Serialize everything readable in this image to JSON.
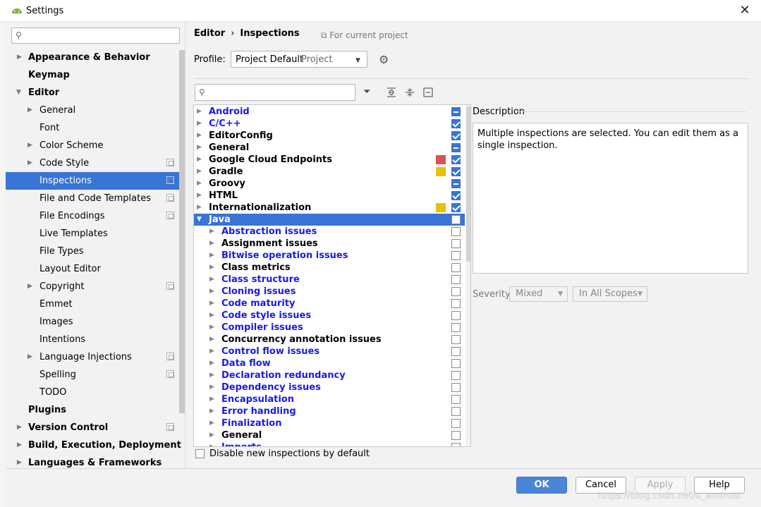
{
  "window": {
    "title": "Settings",
    "close_glyph": "✕"
  },
  "sidebar": {
    "search": {
      "placeholder": ""
    },
    "items": [
      {
        "label": "Appearance & Behavior"
      },
      {
        "label": "Keymap"
      },
      {
        "label": "Editor"
      },
      {
        "label": "General"
      },
      {
        "label": "Font"
      },
      {
        "label": "Color Scheme"
      },
      {
        "label": "Code Style"
      },
      {
        "label": "Inspections"
      },
      {
        "label": "File and Code Templates"
      },
      {
        "label": "File Encodings"
      },
      {
        "label": "Live Templates"
      },
      {
        "label": "File Types"
      },
      {
        "label": "Layout Editor"
      },
      {
        "label": "Copyright"
      },
      {
        "label": "Emmet"
      },
      {
        "label": "Images"
      },
      {
        "label": "Intentions"
      },
      {
        "label": "Language Injections"
      },
      {
        "label": "Spelling"
      },
      {
        "label": "TODO"
      },
      {
        "label": "Plugins"
      },
      {
        "label": "Version Control"
      },
      {
        "label": "Build, Execution, Deployment"
      },
      {
        "label": "Languages & Frameworks"
      }
    ]
  },
  "breadcrumb": {
    "part1": "Editor",
    "separator": "›",
    "part2": "Inspections",
    "scope_note": "For current project"
  },
  "profile": {
    "label": "Profile:",
    "value": "Project Default",
    "scope": "Project"
  },
  "inspections": [
    {
      "name": "Android",
      "state": "partial"
    },
    {
      "name": "C/C++",
      "state": "checked"
    },
    {
      "name": "EditorConfig",
      "state": "checked"
    },
    {
      "name": "General",
      "state": "partial"
    },
    {
      "name": "Google Cloud Endpoints",
      "state": "checked",
      "severity_color": "#d9534f"
    },
    {
      "name": "Gradle",
      "state": "checked",
      "severity_color": "#e6c200"
    },
    {
      "name": "Groovy",
      "state": "partial"
    },
    {
      "name": "HTML",
      "state": "checked"
    },
    {
      "name": "Internationalization",
      "state": "checked",
      "severity_color": "#e6c200"
    },
    {
      "name": "Java",
      "state": "unchecked"
    },
    {
      "name": "Abstraction issues",
      "state": "unchecked"
    },
    {
      "name": "Assignment issues",
      "state": "unchecked"
    },
    {
      "name": "Bitwise operation issues",
      "state": "unchecked"
    },
    {
      "name": "Class metrics",
      "state": "unchecked"
    },
    {
      "name": "Class structure",
      "state": "unchecked"
    },
    {
      "name": "Cloning issues",
      "state": "unchecked"
    },
    {
      "name": "Code maturity",
      "state": "unchecked"
    },
    {
      "name": "Code style issues",
      "state": "unchecked"
    },
    {
      "name": "Compiler issues",
      "state": "unchecked"
    },
    {
      "name": "Concurrency annotation issues",
      "state": "unchecked"
    },
    {
      "name": "Control flow issues",
      "state": "unchecked"
    },
    {
      "name": "Data flow",
      "state": "unchecked"
    },
    {
      "name": "Declaration redundancy",
      "state": "unchecked"
    },
    {
      "name": "Dependency issues",
      "state": "unchecked"
    },
    {
      "name": "Encapsulation",
      "state": "unchecked"
    },
    {
      "name": "Error handling",
      "state": "unchecked"
    },
    {
      "name": "Finalization",
      "state": "unchecked"
    },
    {
      "name": "General",
      "state": "unchecked"
    },
    {
      "name": "Imports",
      "state": "unchecked"
    }
  ],
  "description": {
    "title": "Description",
    "text": "Multiple inspections are selected. You can edit them as a single inspection."
  },
  "severity": {
    "label": "Severity:",
    "value": "Mixed",
    "scope": "In All Scopes"
  },
  "disable_new": {
    "label": "Disable new inspections by default"
  },
  "buttons": {
    "ok": "OK",
    "cancel": "Cancel",
    "apply": "Apply",
    "help": "Help"
  },
  "watermark": "https://blog.csdn.net/u_android"
}
